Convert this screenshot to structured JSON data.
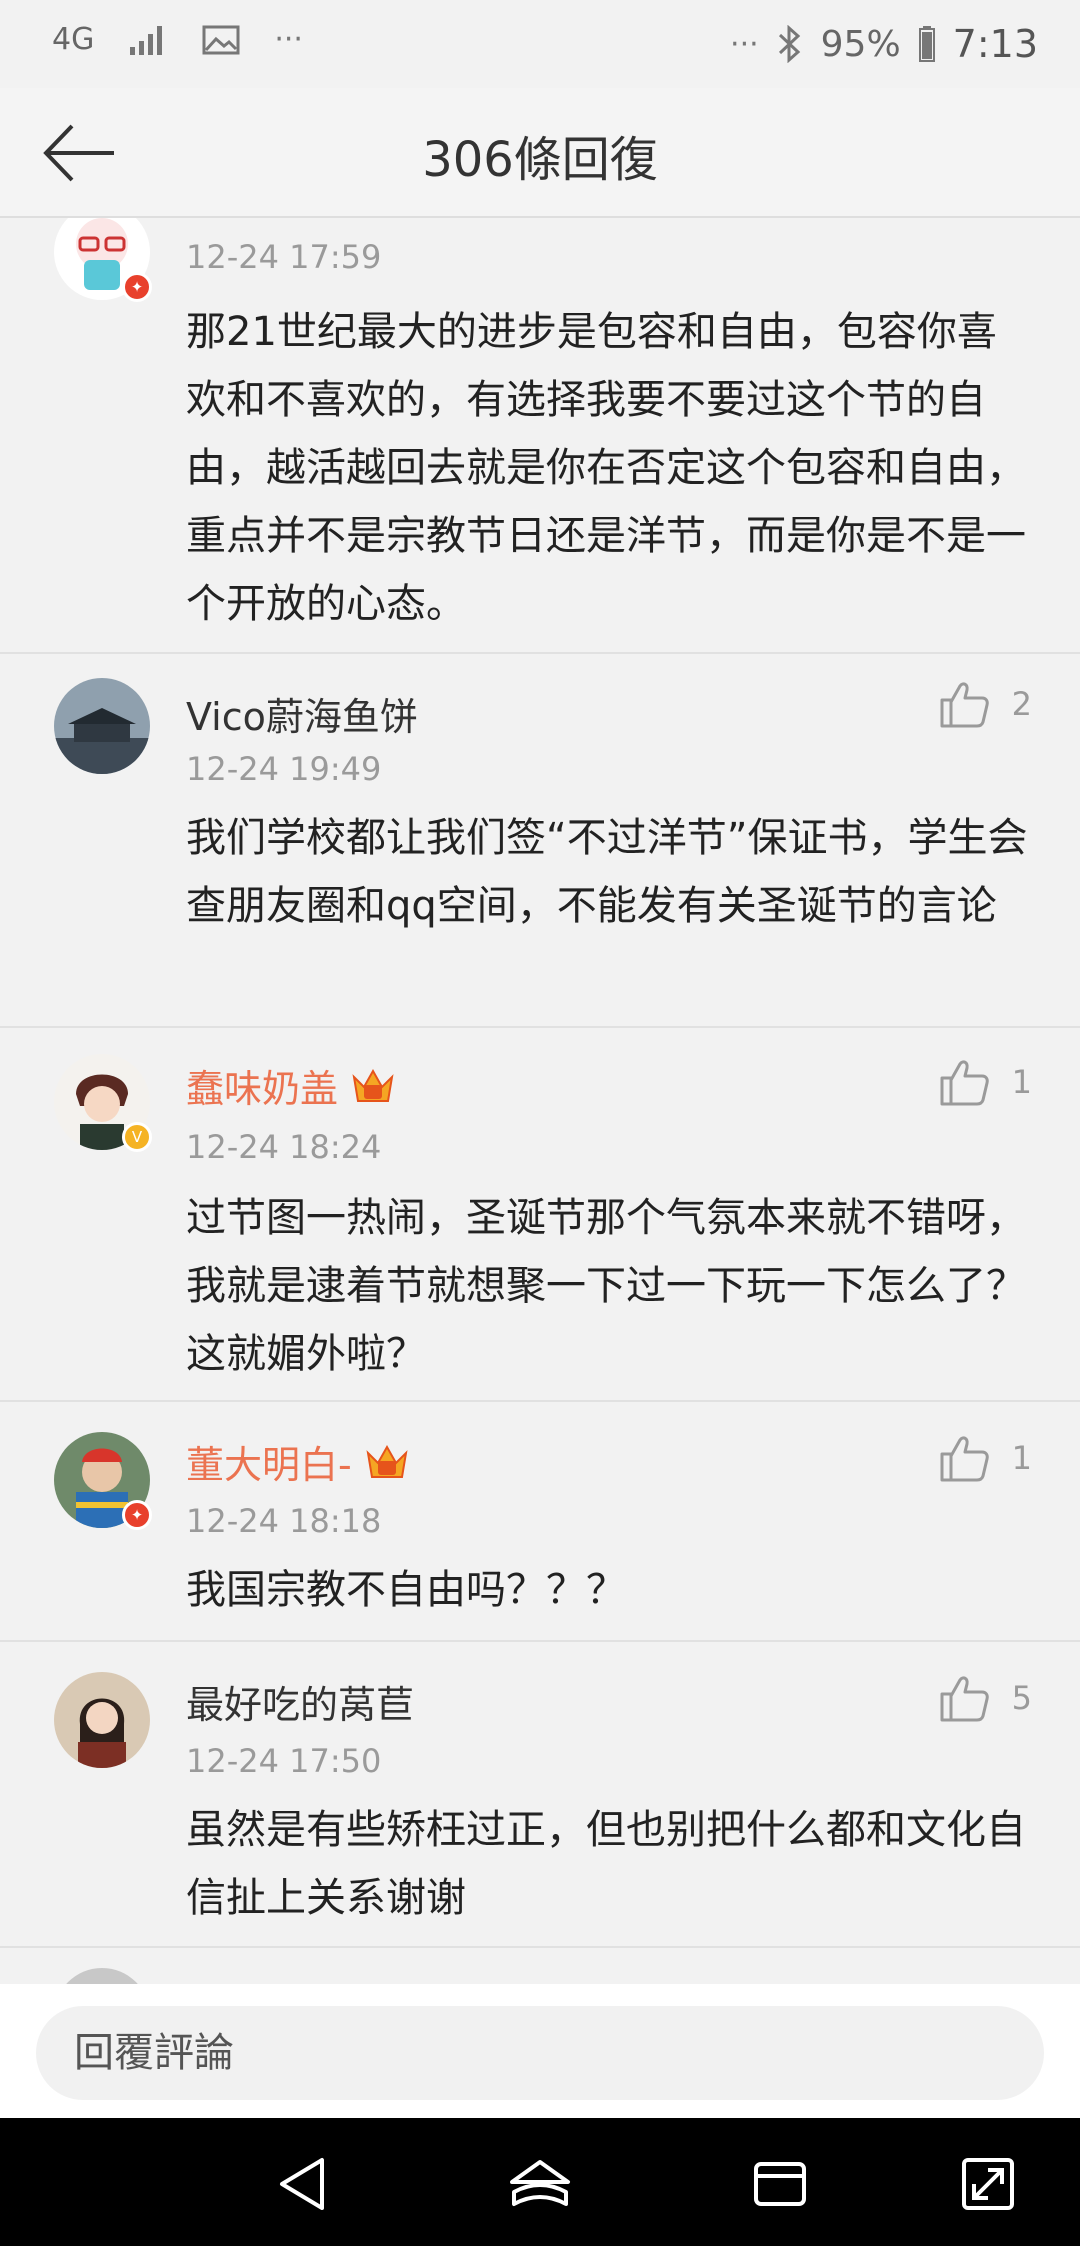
{
  "status_bar": {
    "network": "4G",
    "battery": "95%",
    "time": "7:13",
    "icons": [
      "signal-icon",
      "image-icon",
      "more-icon",
      "bluetooth-icon",
      "battery-icon"
    ]
  },
  "header": {
    "title": "306條回復"
  },
  "comments": [
    {
      "username": "",
      "timestamp": "12-24 17:59",
      "text": "那21世纪最大的进步是包容和自由，包容你喜欢和不喜欢的，有选择我要不要过这个节的自由，越活越回去就是你在否定这个包容和自由，重点并不是宗教节日还是洋节，而是你是不是一个开放的心态。",
      "likes": ""
    },
    {
      "username": "Vico蔚海鱼饼",
      "timestamp": "12-24 19:49",
      "text": "我们学校都让我们签“不过洋节”保证书，学生会查朋友圈和qq空间，不能发有关圣诞节的言论",
      "likes": "2"
    },
    {
      "username": "蠢味奶盖",
      "timestamp": "12-24 18:24",
      "text": "过节图一热闹，圣诞节那个气氛本来就不错呀，我就是逮着节就想聚一下过一下玩一下怎么了？这就媚外啦？",
      "likes": "1"
    },
    {
      "username": "董大明白-",
      "timestamp": "12-24 18:18",
      "text": "我国宗教不自由吗？？？",
      "likes": "1"
    },
    {
      "username": "最好吃的莴苣",
      "timestamp": "12-24 17:50",
      "text": "虽然是有些矫枉过正，但也别把什么都和文化自信扯上关系谢谢",
      "likes": "5"
    }
  ],
  "reply_bar": {
    "placeholder": "回覆評論"
  },
  "colors": {
    "background": "#f2f2f2",
    "vip_name": "#eb7350",
    "timestamp": "#9a9a9a",
    "badge_red": "#e8402c",
    "badge_gold": "#f5b324"
  }
}
